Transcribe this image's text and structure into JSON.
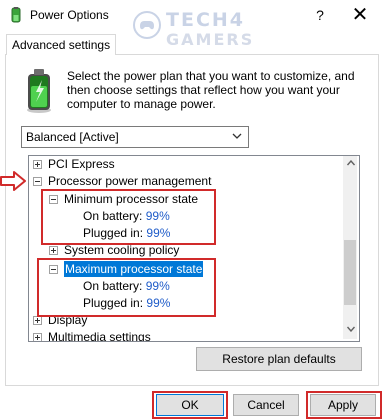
{
  "window": {
    "title": "Power Options",
    "help_glyph": "?",
    "close_glyph": "✕"
  },
  "watermark": {
    "line1": "TECH4",
    "line2": "GAMERS"
  },
  "tab": {
    "label": "Advanced settings"
  },
  "description": "Select the power plan that you want to customize, and then choose settings that reflect how you want your computer to manage power.",
  "plan_select": {
    "value": "Balanced [Active]"
  },
  "tree": {
    "items": [
      {
        "label": "PCI Express",
        "state": "collapsed"
      },
      {
        "label": "Processor power management",
        "state": "expanded"
      },
      {
        "label": "Minimum processor state",
        "state": "expanded",
        "on_battery_label": "On battery:",
        "on_battery_value": "99%",
        "plugged_in_label": "Plugged in:",
        "plugged_in_value": "99%"
      },
      {
        "label": "System cooling policy",
        "state": "collapsed"
      },
      {
        "label": "Maximum processor state",
        "state": "expanded",
        "selected": true,
        "on_battery_label": "On battery:",
        "on_battery_value": "99%",
        "plugged_in_label": "Plugged in:",
        "plugged_in_value": "99%"
      },
      {
        "label": "Display",
        "state": "collapsed"
      },
      {
        "label": "Multimedia settings",
        "state": "collapsed"
      }
    ]
  },
  "buttons": {
    "restore": "Restore plan defaults",
    "ok": "OK",
    "cancel": "Cancel",
    "apply": "Apply"
  },
  "colors": {
    "highlight": "#d12a2a",
    "selection": "#0078d7",
    "value_text": "#1f5cc9"
  }
}
